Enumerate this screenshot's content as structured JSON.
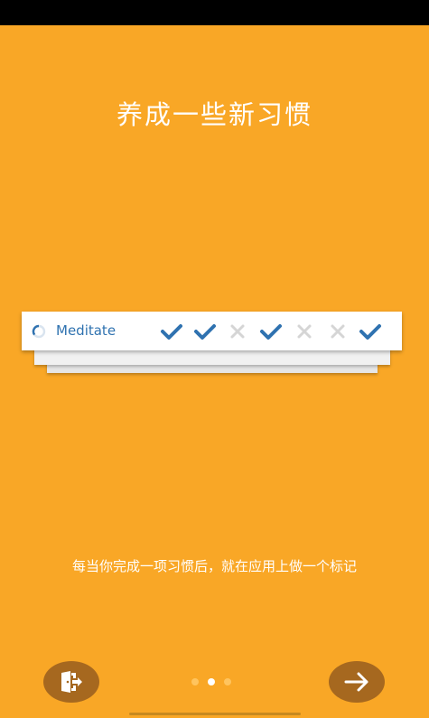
{
  "onboarding": {
    "title": "养成一些新习惯",
    "description": "每当你完成一项习惯后，就在应用上做一个标记",
    "page_index": 2,
    "page_count": 3
  },
  "habit_card": {
    "name": "Meditate",
    "ring_icon": "progress-ring-icon",
    "days": [
      {
        "status": "checked",
        "icon": "check-icon"
      },
      {
        "status": "checked",
        "icon": "check-icon"
      },
      {
        "status": "unchecked",
        "icon": "cross-icon"
      },
      {
        "status": "checked",
        "icon": "check-icon"
      },
      {
        "status": "unchecked",
        "icon": "cross-icon"
      },
      {
        "status": "unchecked",
        "icon": "cross-icon"
      },
      {
        "status": "checked",
        "icon": "check-icon"
      }
    ]
  },
  "buttons": {
    "skip_icon": "exit-door-icon",
    "next_icon": "arrow-right-icon"
  },
  "colors": {
    "background": "#F9A726",
    "button": "#A6681F",
    "accent_blue": "#2F72B0",
    "cross_gray": "#D5D5D5",
    "dot_inactive": "#FFC45E",
    "dot_active": "#FFFFFF"
  }
}
